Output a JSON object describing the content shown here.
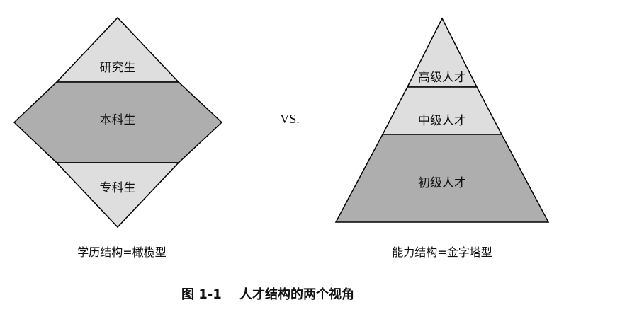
{
  "left_diagram": {
    "top_label": "研究生",
    "middle_label": "本科生",
    "bottom_label": "专科生",
    "caption": "学历结构=橄榄型"
  },
  "vs_label": "VS.",
  "right_diagram": {
    "top_label": "高级人才",
    "middle_label": "中级人才",
    "bottom_label": "初级人才",
    "caption": "能力结构=金字塔型"
  },
  "figure_number": "图 1-1",
  "figure_title": "人才结构的两个视角",
  "colors": {
    "light_fill": "#dedede",
    "dark_fill": "#aeaeae",
    "stroke": "#000000"
  }
}
